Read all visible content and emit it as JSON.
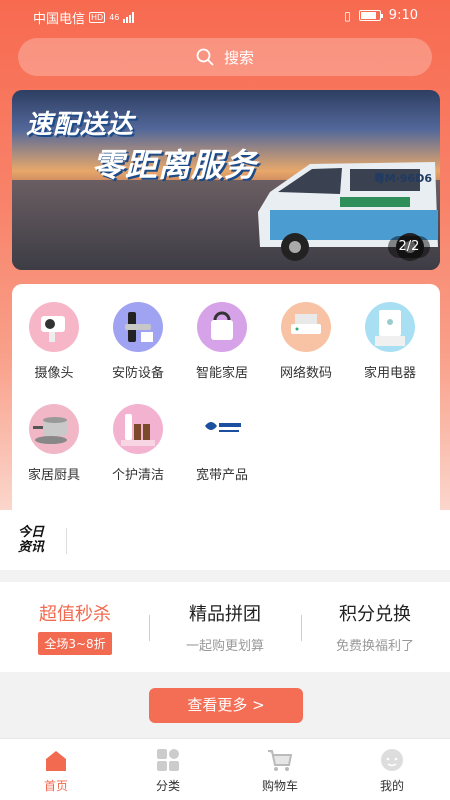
{
  "status": {
    "carrier": "中国电信",
    "hd": "HD",
    "network": "46",
    "time": "9:10"
  },
  "search": {
    "label": "搜索",
    "icon": "search-icon"
  },
  "banner": {
    "line1": "速配送达",
    "line2": "零距离服务",
    "plate": "粤M·96D6",
    "pager": "2/2"
  },
  "categories": [
    {
      "label": "摄像头",
      "icon": "camera-icon",
      "color": "#f6b6c8"
    },
    {
      "label": "安防设备",
      "icon": "smart-lock-icon",
      "color": "#9fa3f2"
    },
    {
      "label": "智能家居",
      "icon": "smart-home-icon",
      "color": "#d6a2e8"
    },
    {
      "label": "网络数码",
      "icon": "router-icon",
      "color": "#f7c3a4"
    },
    {
      "label": "家用电器",
      "icon": "water-heater-icon",
      "color": "#a8dff2"
    },
    {
      "label": "家居厨具",
      "icon": "cookware-icon",
      "color": "#f2b7c7"
    },
    {
      "label": "个护清洁",
      "icon": "personal-care-icon",
      "color": "#f3b3d0"
    },
    {
      "label": "宽带产品",
      "icon": "china-telecom-logo",
      "color": "#ffffff"
    }
  ],
  "news": {
    "logo": "今日资讯"
  },
  "promo": [
    {
      "title": "超值秒杀",
      "tag": "全场3~8折"
    },
    {
      "title": "精品拼团",
      "sub": "一起购更划算"
    },
    {
      "title": "积分兑换",
      "sub": "免费换福利了"
    }
  ],
  "more_button": "查看更多 >",
  "tabs": [
    {
      "label": "首页",
      "icon": "home-icon",
      "active": true
    },
    {
      "label": "分类",
      "icon": "category-icon",
      "active": false
    },
    {
      "label": "购物车",
      "icon": "cart-icon",
      "active": false
    },
    {
      "label": "我的",
      "icon": "profile-icon",
      "active": false
    }
  ],
  "colors": {
    "accent": "#f26a4f"
  }
}
